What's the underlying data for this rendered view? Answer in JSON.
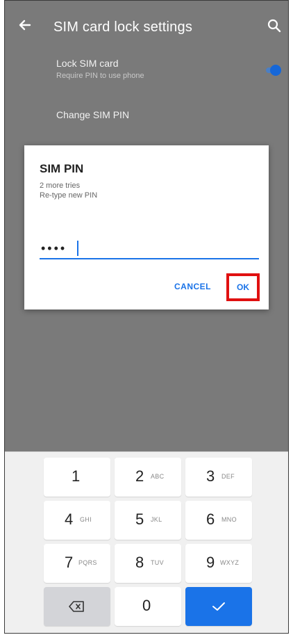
{
  "app_bar": {
    "title": "SIM card lock settings",
    "back_icon": "arrow-left-icon",
    "search_icon": "search-icon"
  },
  "settings": {
    "lock_sim_title": "Lock SIM card",
    "lock_sim_subtitle": "Require PIN to use phone",
    "lock_sim_enabled": true,
    "change_pin_label": "Change SIM PIN"
  },
  "dialog": {
    "title": "SIM PIN",
    "subtitle_line1": "2 more tries",
    "subtitle_line2": "Re-type new PIN",
    "pin_value": "••••",
    "cancel_label": "CANCEL",
    "ok_label": "OK"
  },
  "keypad": {
    "keys": [
      {
        "num": "1",
        "letters": ""
      },
      {
        "num": "2",
        "letters": "ABC"
      },
      {
        "num": "3",
        "letters": "DEF"
      },
      {
        "num": "4",
        "letters": "GHI"
      },
      {
        "num": "5",
        "letters": "JKL"
      },
      {
        "num": "6",
        "letters": "MNO"
      },
      {
        "num": "7",
        "letters": "PQRS"
      },
      {
        "num": "8",
        "letters": "TUV"
      },
      {
        "num": "9",
        "letters": "WXYZ"
      },
      {
        "num": "0",
        "letters": ""
      }
    ],
    "backspace_icon": "backspace-icon",
    "done_icon": "checkmark-icon"
  },
  "colors": {
    "accent": "#1a73e8",
    "highlight": "#e01010",
    "scrim": "#7a7a7a"
  }
}
